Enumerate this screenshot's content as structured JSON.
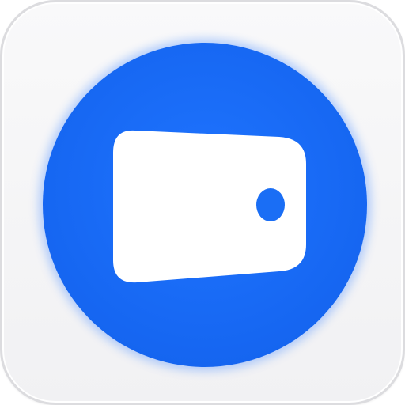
{
  "app_icon": {
    "icon_name": "wallet-icon",
    "colors": {
      "frame": "#f4f4f6",
      "frame_border": "#dcdcdf",
      "disc": "#1a6ef5",
      "disc_glow": "#3b84ff",
      "card": "#ffffff",
      "clasp": "#1a6ef5"
    }
  }
}
